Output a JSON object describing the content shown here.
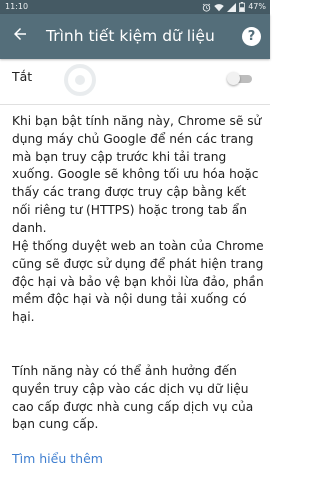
{
  "status_bar": {
    "time": "11:10",
    "battery_percent": "47%",
    "icons": [
      "alarm-icon",
      "wifi-icon",
      "cellular-signal-icon",
      "battery-icon"
    ]
  },
  "app_bar": {
    "title": "Trình tiết kiệm dữ liệu",
    "back_icon": "arrow-back-icon",
    "help_label": "?"
  },
  "setting": {
    "label": "Tắt",
    "enabled": false
  },
  "content": {
    "paragraph_1": "Khi bạn bật tính năng này, Chrome sẽ sử dụng máy chủ Google để nén các trang mà bạn truy cập trước khi tải trang xuống. Google sẽ không tối ưu hóa hoặc thấy các trang được truy cập bằng kết nối riêng tư (HTTPS) hoặc trong tab ẩn danh.",
    "paragraph_2": "Hệ thống duyệt web an toàn của Chrome cũng sẽ được sử dụng để phát hiện trang độc hại và bảo vệ bạn khỏi lừa đảo, phần mềm độc hại và nội dung tải xuống có hại.",
    "paragraph_3": "Tính năng này có thể ảnh hưởng đến quyền truy cập vào các dịch vụ dữ liệu cao cấp được nhà cung cấp dịch vụ của bạn cung cấp.",
    "learn_more": "Tìm hiểu thêm"
  },
  "colors": {
    "status_bar": "#455a64",
    "app_bar": "#546e7a",
    "link": "#3f7fd0",
    "toggle_off_track": "#bdbdbd"
  }
}
